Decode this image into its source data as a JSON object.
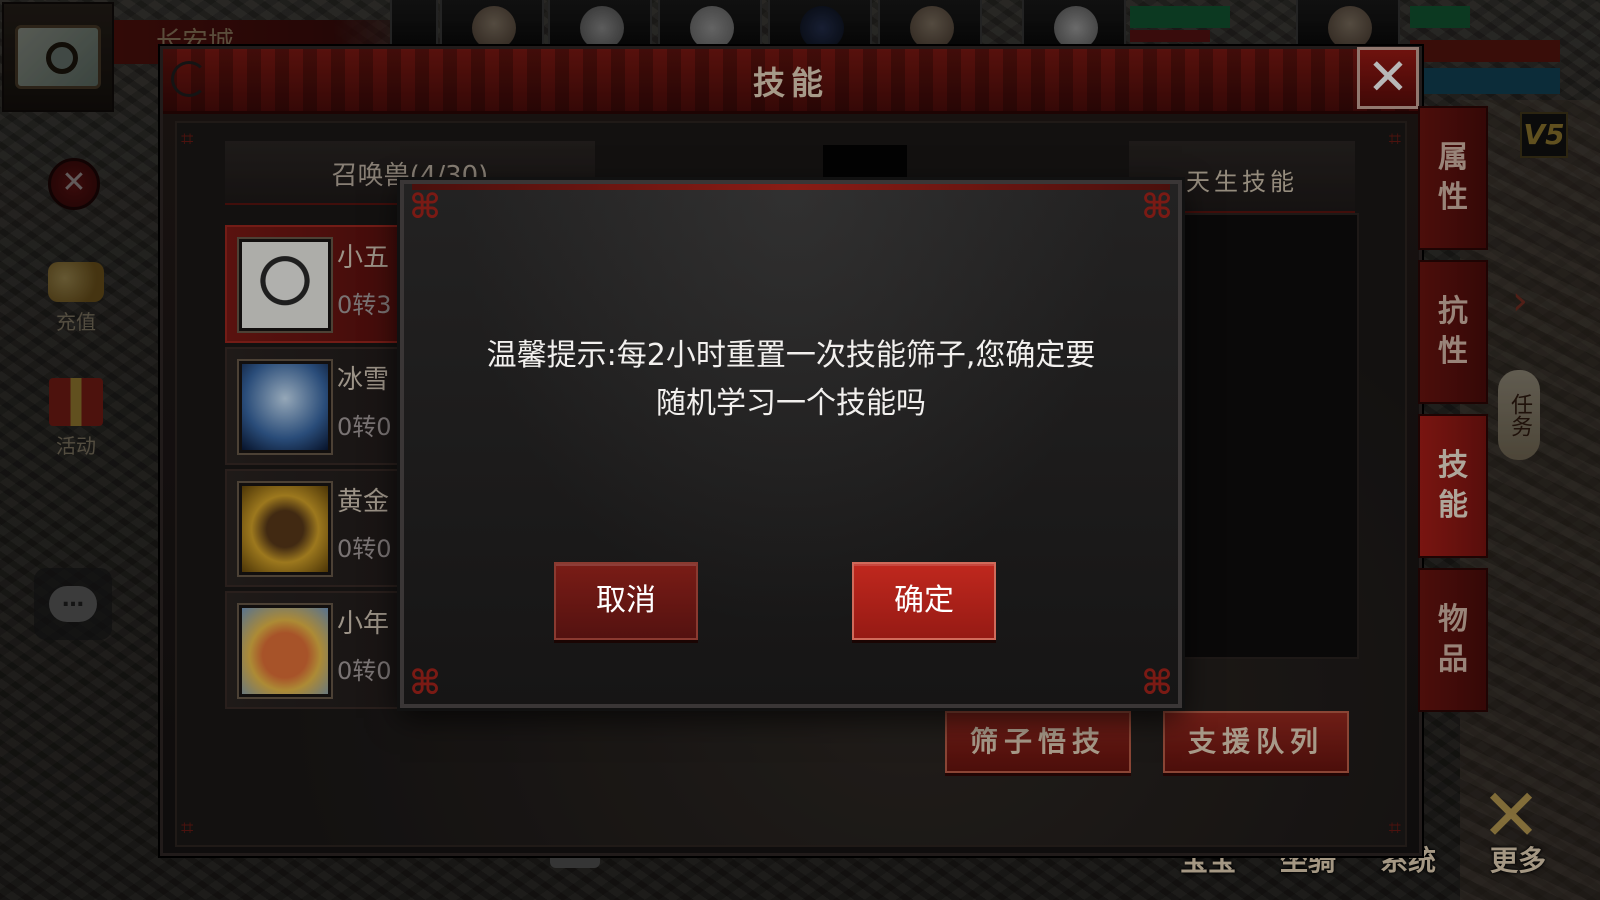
{
  "hud": {
    "city_name": "长安城",
    "recharge_label": "充值",
    "activity_label": "活动",
    "chat_icon": "…",
    "quest_label": "任务",
    "vip_badge": "V5",
    "bottom_menu": [
      "宝宝",
      "坐骑",
      "系统",
      "更多"
    ]
  },
  "panel": {
    "title": "技能",
    "close_icon": "✕",
    "list_header": "召唤兽(4/30)",
    "pets": [
      {
        "name": "小五",
        "level": "0转3",
        "icon": "panda-icon",
        "selected": true
      },
      {
        "name": "冰雪",
        "level": "0转0",
        "icon": "ice-beast-icon",
        "selected": false
      },
      {
        "name": "黄金",
        "level": "0转0",
        "icon": "golden-beast-icon",
        "selected": false
      },
      {
        "name": "小年",
        "level": "0转0",
        "icon": "nian-beast-icon",
        "selected": false
      }
    ],
    "innate_skills_header": "天生技能",
    "buttons": {
      "dice_skill": "筛子悟技",
      "support_team": "支援队列"
    }
  },
  "side_tabs": [
    {
      "label": "属性",
      "active": false
    },
    {
      "label": "抗性",
      "active": false
    },
    {
      "label": "技能",
      "active": true
    },
    {
      "label": "物品",
      "active": false
    }
  ],
  "dialog": {
    "message_line1": "温馨提示:每2小时重置一次技能筛子,您确定要",
    "message_line2": "随机学习一个技能吗",
    "cancel_label": "取消",
    "confirm_label": "确定"
  },
  "colors": {
    "accent_red": "#c0281e",
    "panel_bg": "#1b1817",
    "text_light": "#f2f0ee"
  }
}
